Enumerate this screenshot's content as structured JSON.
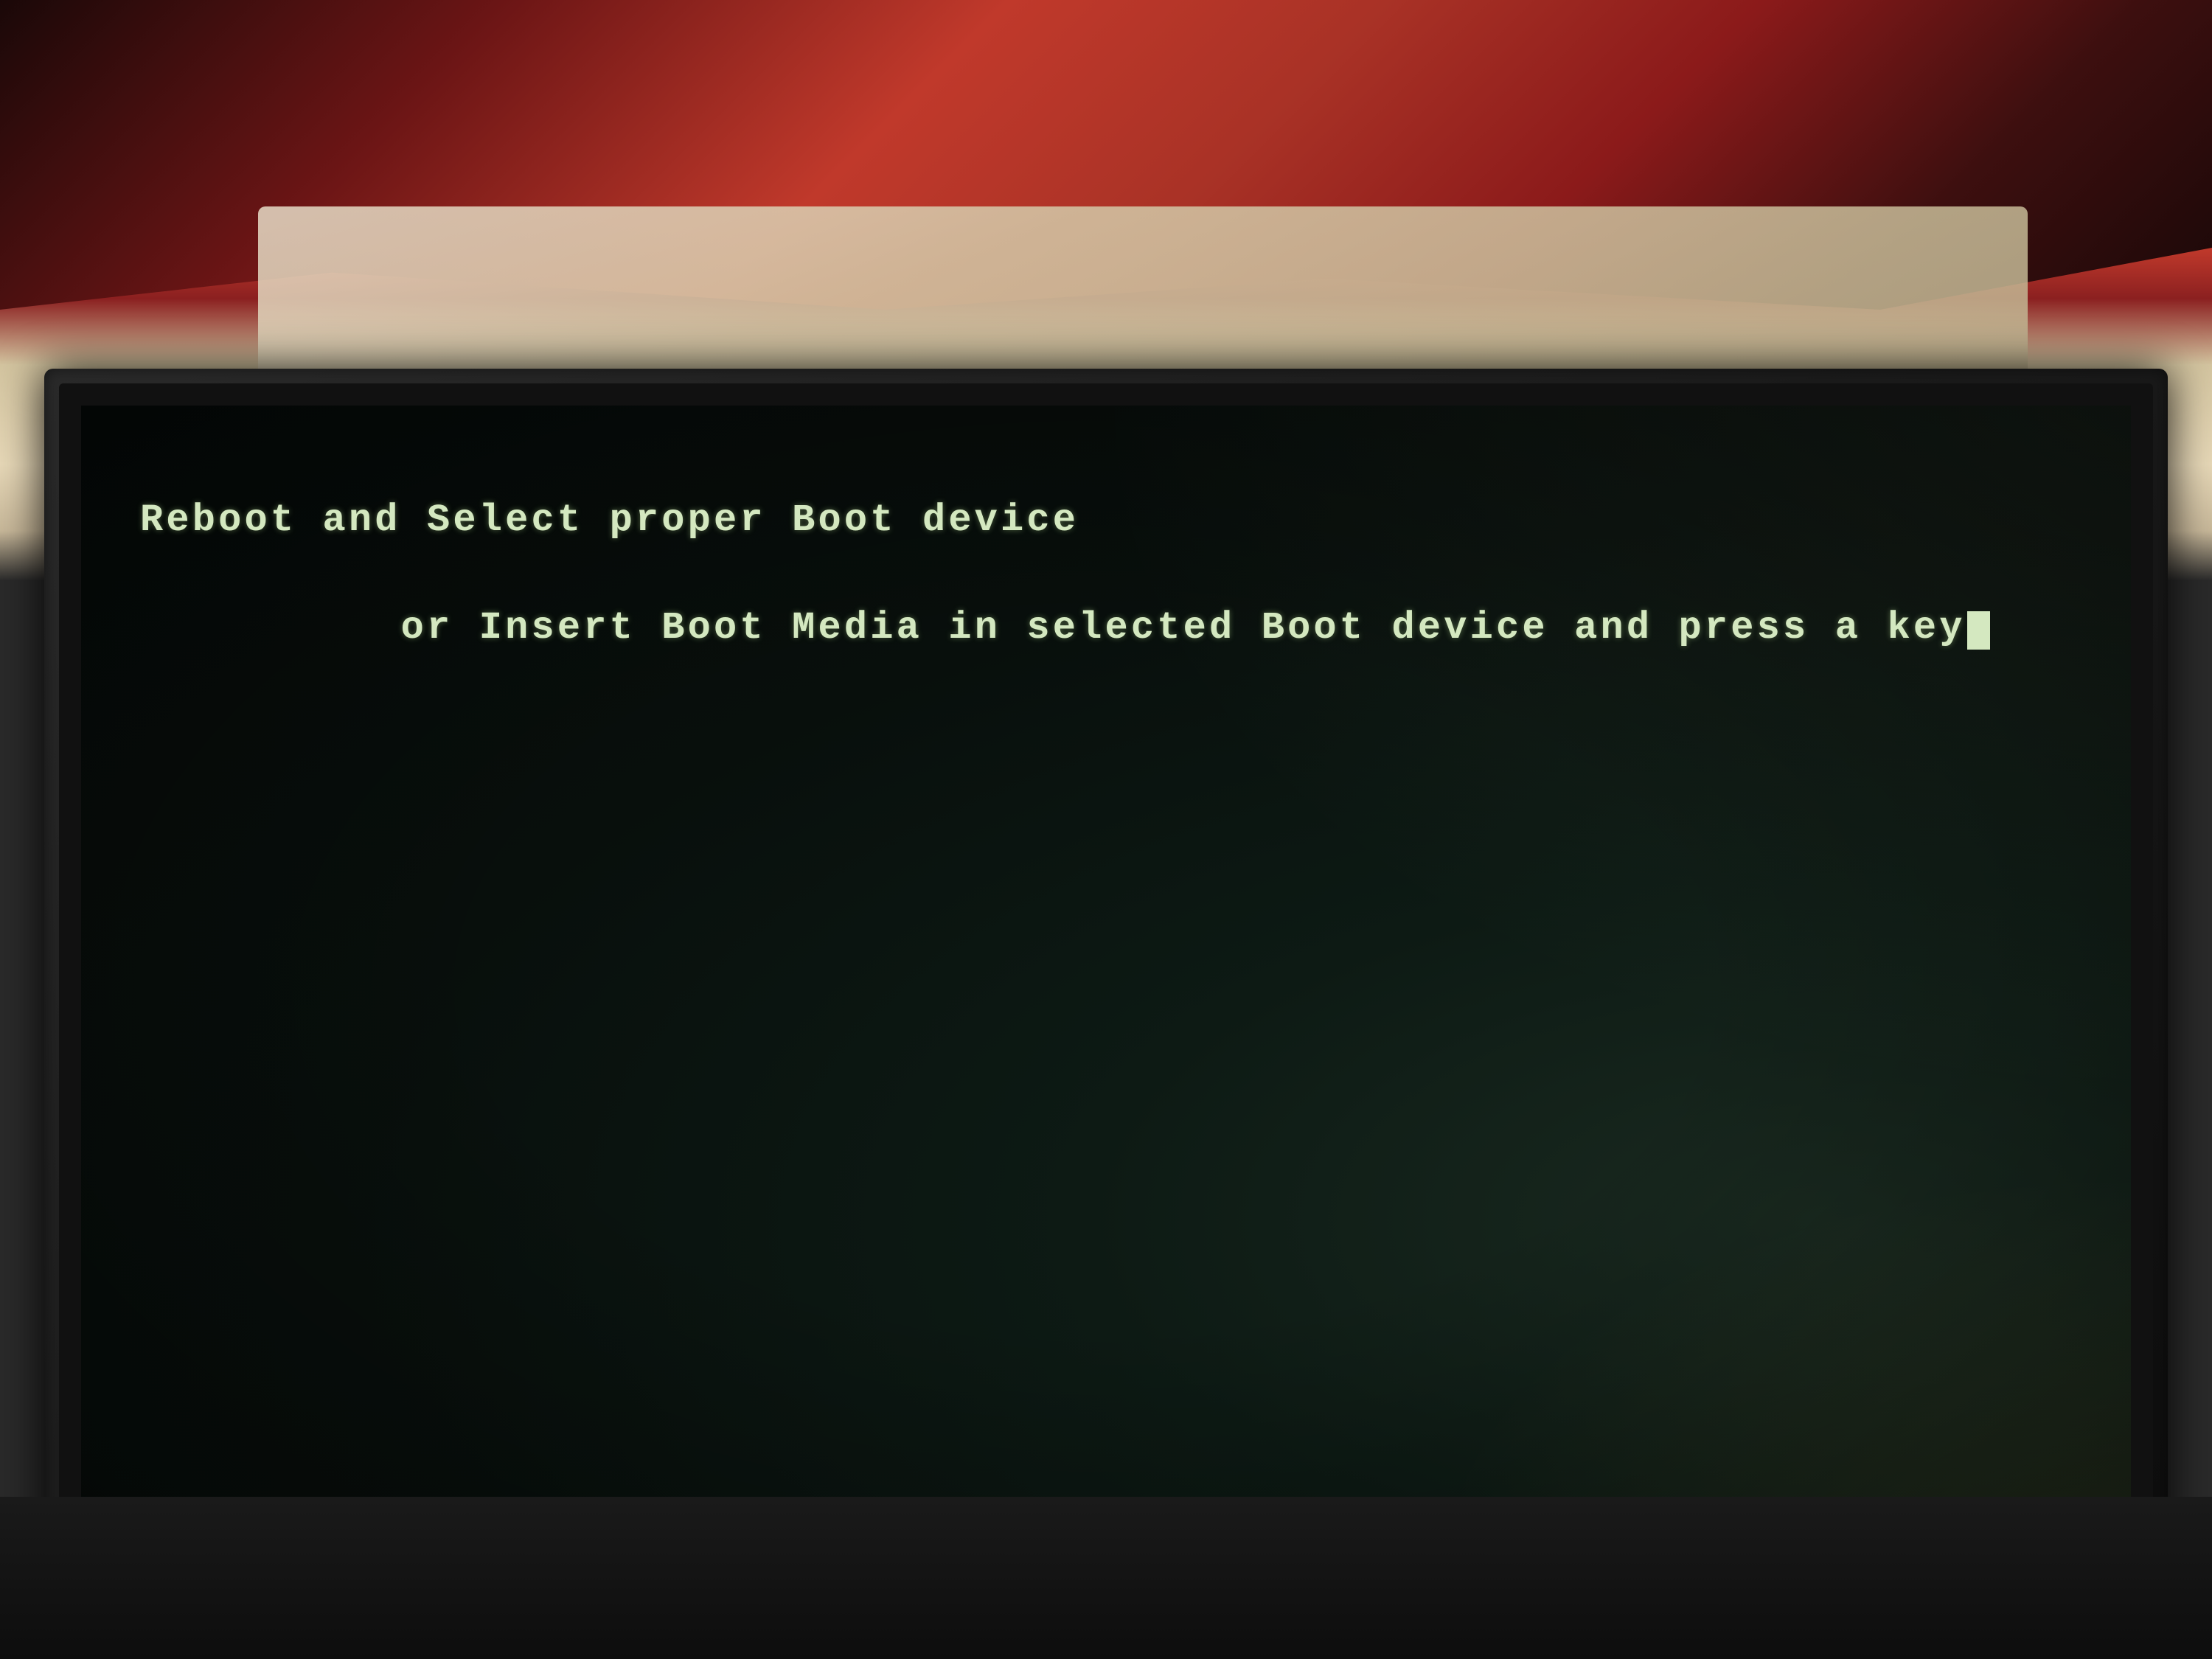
{
  "environment": {
    "description": "Computer monitor displaying boot error screen",
    "background_color": "#2a1a1a",
    "top_color": "#c0392b",
    "wall_color": "#d4c9a8"
  },
  "screen": {
    "background_color": "#080f0c",
    "text_color": "#d4e8c0"
  },
  "boot_message": {
    "line1": "Reboot and Select proper Boot device",
    "line2": "or Insert Boot Media in selected Boot device and press a key"
  }
}
